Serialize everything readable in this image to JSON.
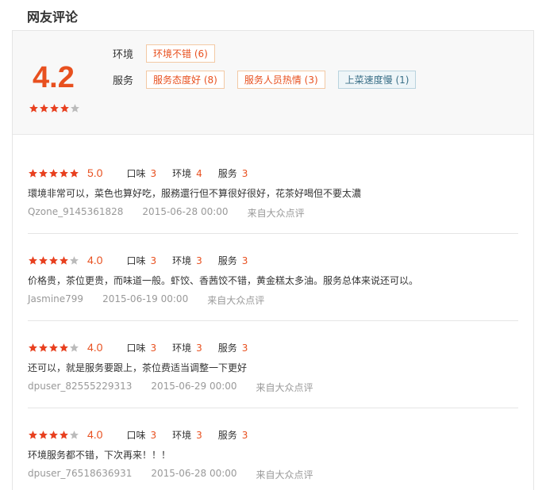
{
  "section_title": "网友评论",
  "summary": {
    "score": "4.2",
    "stars": 4,
    "environment_label": "环境",
    "service_label": "服务",
    "environment_tags": [
      {
        "label": "环境不错 (6)",
        "type": "positive"
      }
    ],
    "service_tags": [
      {
        "label": "服务态度好 (8)",
        "type": "positive"
      },
      {
        "label": "服务人员热情 (3)",
        "type": "positive"
      },
      {
        "label": "上菜速度慢 (1)",
        "type": "negative"
      }
    ]
  },
  "rating_labels": {
    "taste": "口味",
    "environment": "环境",
    "service": "服务"
  },
  "reviews": [
    {
      "stars": 5,
      "score": "5.0",
      "taste": "3",
      "environment": "4",
      "service": "3",
      "text": "環境非常可以，菜色也算好吃，服務還行但不算很好很好，花茶好喝但不要太濃",
      "user": "Qzone_9145361828",
      "date": "2015-06-28 00:00",
      "source": "来自大众点评"
    },
    {
      "stars": 4,
      "score": "4.0",
      "taste": "3",
      "environment": "3",
      "service": "3",
      "text": "价格贵，茶位更贵，而味道一般。虾饺、香茜饺不错，黄金糕太多油。服务总体来说还可以。",
      "user": "Jasmine799",
      "date": "2015-06-19 00:00",
      "source": "来自大众点评"
    },
    {
      "stars": 4,
      "score": "4.0",
      "taste": "3",
      "environment": "3",
      "service": "3",
      "text": "还可以，就是服务要跟上，茶位费适当调整一下更好",
      "user": "dpuser_82555229313",
      "date": "2015-06-29 00:00",
      "source": "来自大众点评"
    },
    {
      "stars": 4,
      "score": "4.0",
      "taste": "3",
      "environment": "3",
      "service": "3",
      "text": "环境服务都不错，下次再来！！！",
      "user": "dpuser_76518636931",
      "date": "2015-06-28 00:00",
      "source": "来自大众点评"
    }
  ],
  "colors": {
    "accent": "#e8501f",
    "star_on": "#e8401f",
    "star_off": "#bbbbbb"
  }
}
